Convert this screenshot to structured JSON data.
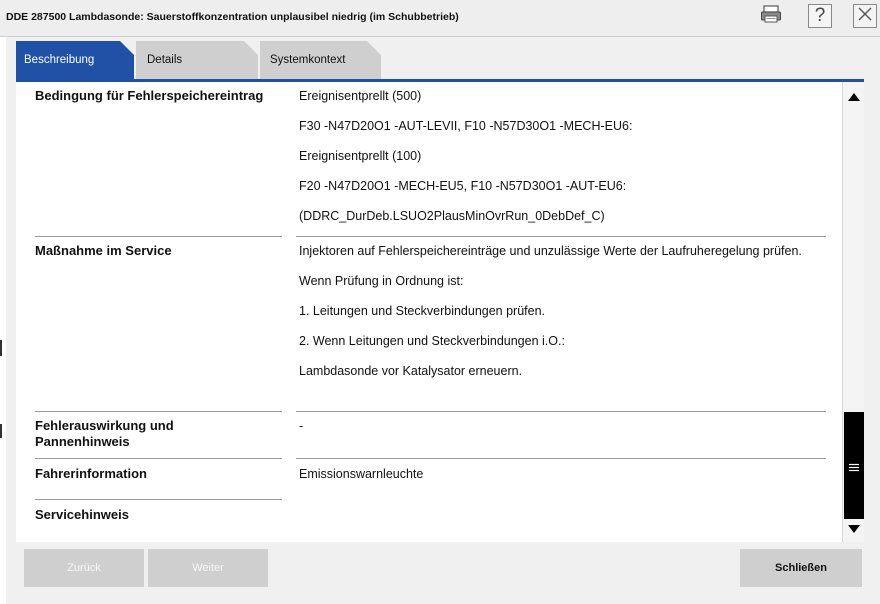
{
  "window": {
    "title": "DDE 287500 Lambdasonde: Sauerstoffkonzentration unplausibel niedrig (im Schubbetrieb)",
    "icons": [
      "printer-icon",
      "help-icon",
      "close-icon"
    ],
    "help_glyph": "?"
  },
  "tabs": [
    {
      "label": "Beschreibung",
      "active": true
    },
    {
      "label": "Details",
      "active": false
    },
    {
      "label": "Systemkontext",
      "active": false
    }
  ],
  "rows": [
    {
      "label": "Bedingung für Fehlerspeichereintrag",
      "values": [
        "Ereignisentprellt (500)",
        "F30 -N47D20O1 -AUT-LEVII, F10 -N57D30O1 -MECH-EU6:",
        "Ereignisentprellt (100)",
        "F20 -N47D20O1 -MECH-EU5, F10 -N57D30O1 -AUT-EU6:",
        "(DDRC_DurDeb.LSUO2PlausMinOvrRun_0DebDef_C)"
      ]
    },
    {
      "label": "Maßnahme im Service",
      "values": [
        "Injektoren auf Fehlerspeichereinträge und unzulässige Werte der Laufruheregelung prüfen.",
        "Wenn Prüfung in Ordnung ist:",
        "1. Leitungen und Steckverbindungen prüfen.",
        "2. Wenn Leitungen und Steckverbindungen i.O.:",
        "Lambdasonde vor Katalysator erneuern."
      ]
    },
    {
      "label": "Fehlerauswirkung und Pannenhinweis",
      "values": [
        "-"
      ]
    },
    {
      "label": "Fahrerinformation",
      "values": [
        "Emissionswarnleuchte"
      ]
    },
    {
      "label": "Servicehinweis",
      "values": []
    }
  ],
  "buttons": {
    "back": "Zurück",
    "next": "Weiter",
    "close": "Schließen"
  },
  "colors": {
    "accent": "#1f52a6",
    "tab_inactive": "#cfcfcf",
    "frame": "#f0f0f0",
    "scroll_thumb": "#000000"
  }
}
